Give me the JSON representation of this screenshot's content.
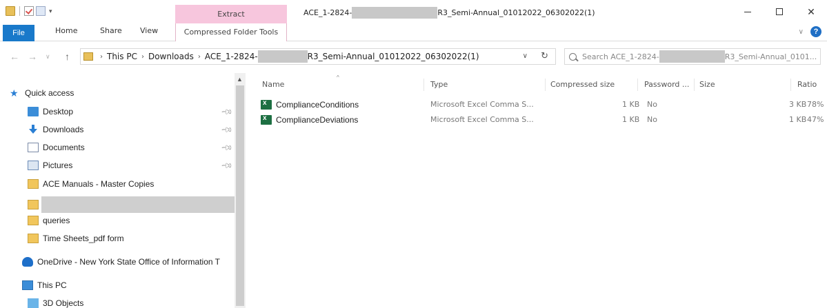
{
  "titlebar": {
    "extract_tab": "Extract",
    "title_prefix": "ACE_1-2824-",
    "title_suffix": "R3_Semi-Annual_01012022_06302022(1)",
    "close_glyph": "✕"
  },
  "ribbon": {
    "tabs": {
      "file": "File",
      "home": "Home",
      "share": "Share",
      "view": "View"
    },
    "compressed_folder_tools": "Compressed Folder Tools",
    "help": "?"
  },
  "address": {
    "segments": [
      "This PC",
      "Downloads"
    ],
    "folder_prefix": "ACE_1-2824-",
    "folder_suffix": "R3_Semi-Annual_01012022_06302022(1)",
    "search_prefix": "Search ACE_1-2824-",
    "search_suffix": "R3_Semi-Annual_0101..."
  },
  "navpane": {
    "quick_access": "Quick access",
    "items": [
      {
        "label": "Desktop",
        "icon": "desktop-icon",
        "pinned": true
      },
      {
        "label": "Downloads",
        "icon": "downloads-icon",
        "pinned": true
      },
      {
        "label": "Documents",
        "icon": "documents-icon",
        "pinned": true
      },
      {
        "label": "Pictures",
        "icon": "pictures-icon",
        "pinned": true
      },
      {
        "label": "ACE Manuals - Master Copies",
        "icon": "folder-icon",
        "pinned": false
      },
      {
        "label": "",
        "icon": "folder-icon",
        "pinned": false
      },
      {
        "label": "queries",
        "icon": "folder-icon",
        "pinned": false
      },
      {
        "label": "Time Sheets_pdf form",
        "icon": "folder-icon",
        "pinned": false
      }
    ],
    "onedrive": "OneDrive - New York State Office of Information T",
    "this_pc": "This PC",
    "objects_3d": "3D Objects"
  },
  "filelist": {
    "columns": [
      "Name",
      "Type",
      "Compressed size",
      "Password ...",
      "Size",
      "Ratio"
    ],
    "rows": [
      {
        "name": "ComplianceConditions",
        "type": "Microsoft Excel Comma S...",
        "compressed": "1 KB",
        "password": "No",
        "size": "3 KB",
        "ratio": "78%"
      },
      {
        "name": "ComplianceDeviations",
        "type": "Microsoft Excel Comma S...",
        "compressed": "1 KB",
        "password": "No",
        "size": "1 KB",
        "ratio": "47%"
      }
    ]
  },
  "colors": {
    "file_tab": "#1979ca",
    "extract_tab": "#f7c6dd",
    "excel_icon": "#1d6f42",
    "folder": "#f1c65c"
  }
}
